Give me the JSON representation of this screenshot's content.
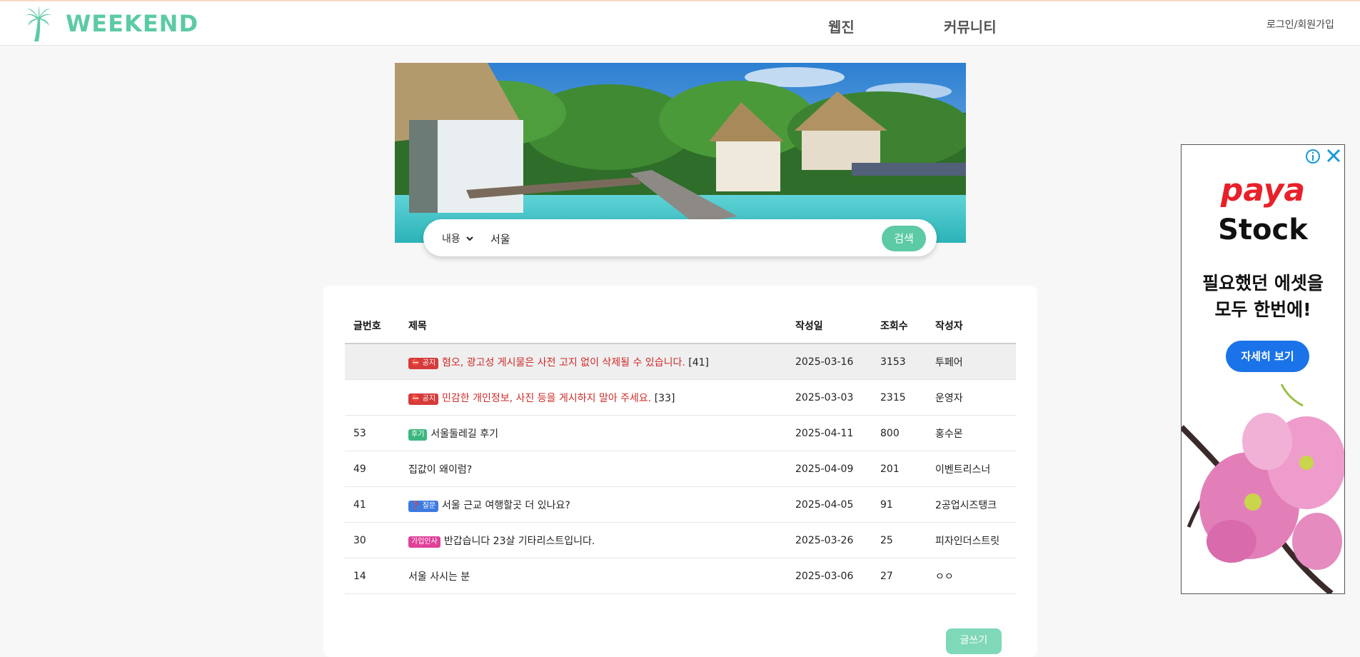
{
  "header": {
    "logo_text": "WEEKEND",
    "nav": [
      "웹진",
      "커뮤니티"
    ],
    "login_label": "로그인/회원가입"
  },
  "search": {
    "select_value": "내용",
    "query": "서울",
    "button_label": "검색"
  },
  "board": {
    "columns": [
      "글번호",
      "제목",
      "작성일",
      "조회수",
      "작성자"
    ],
    "rows": [
      {
        "no": "",
        "badge": "공지",
        "title": "혐오, 광고성 게시물은 사전 고지 없이 삭제될 수 있습니다.",
        "comments": "[41]",
        "date": "2025-03-16",
        "views": "3153",
        "author": "투페어"
      },
      {
        "no": "",
        "badge": "공지",
        "title": "민감한 개인정보, 사진 등을 게시하지 말아 주세요.",
        "comments": "[33]",
        "date": "2025-03-03",
        "views": "2315",
        "author": "운영자"
      },
      {
        "no": "53",
        "badge": "후기",
        "title": "서울둘레길 후기",
        "comments": "",
        "date": "2025-04-11",
        "views": "800",
        "author": "홍수몬"
      },
      {
        "no": "49",
        "badge": "",
        "title": "집값이 왜이럼?",
        "comments": "",
        "date": "2025-04-09",
        "views": "201",
        "author": "이벤트리스너"
      },
      {
        "no": "41",
        "badge": "질문",
        "title": "서울 근교 여행할곳 더 있나요?",
        "comments": "",
        "date": "2025-04-05",
        "views": "91",
        "author": "2공업시즈탱크"
      },
      {
        "no": "30",
        "badge": "가입인사",
        "title": "반갑습니다 23살 기타리스트입니다.",
        "comments": "",
        "date": "2025-03-26",
        "views": "25",
        "author": "피자인더스트릿"
      },
      {
        "no": "14",
        "badge": "",
        "title": "서울 사시는 분",
        "comments": "",
        "date": "2025-03-06",
        "views": "27",
        "author": "ㅇㅇ"
      }
    ],
    "write_label": "글쓰기"
  },
  "ad": {
    "brand_line1": "paya",
    "brand_line2": "Stock",
    "copy_line1": "필요했던 에셋을",
    "copy_line2": "모두 한번에!",
    "button_label": "자세히 보기"
  },
  "colors": {
    "brand": "#5ccaa5",
    "notice": "#d63b3b",
    "review": "#3bb77e",
    "question": "#3e7be0",
    "greeting": "#e0409a",
    "ad_red": "#e8202a",
    "ad_blue": "#1a73e8"
  },
  "icons": [
    "palm-tree-icon",
    "chevron-down-icon",
    "notice-icon",
    "question-icon",
    "ad-info-icon",
    "close-icon"
  ]
}
